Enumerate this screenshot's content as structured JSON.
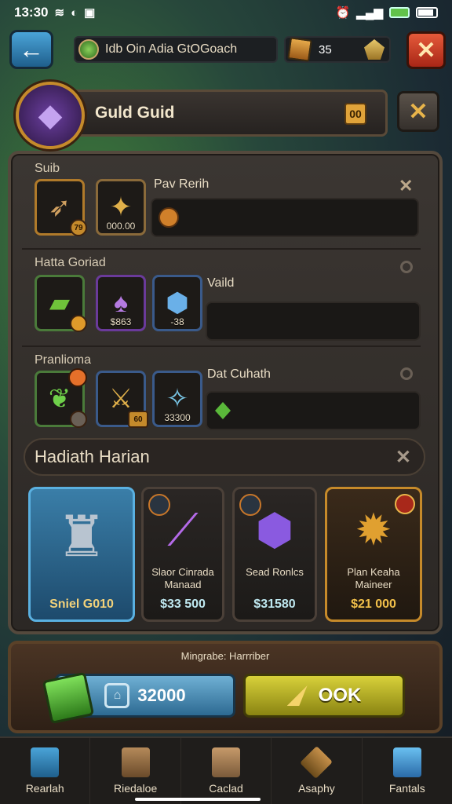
{
  "status": {
    "time": "13:30"
  },
  "topbar": {
    "player_name": "Idb Oin Adia GtOGoach",
    "currency": "35"
  },
  "guild": {
    "title": "Guld Guid",
    "badge": "00"
  },
  "sections": [
    {
      "title": "Suib",
      "items": [
        {
          "value": "",
          "badge": "79"
        },
        {
          "value": "000.00"
        }
      ],
      "label": "Pav Rerih"
    },
    {
      "title": "Hatta Goriad",
      "items": [
        {
          "value": ""
        },
        {
          "value": "$863"
        },
        {
          "value": "-38"
        }
      ],
      "label": "Vaild"
    },
    {
      "title": "Pranlioma",
      "items": [
        {
          "value": ""
        },
        {
          "value": "60"
        },
        {
          "value": "33300"
        }
      ],
      "label": "Dat Cuhath"
    }
  ],
  "shop": {
    "header": "Hadiath Harian",
    "cards": [
      {
        "name": "",
        "price": "Sniel G010"
      },
      {
        "name": "Slaor Cinrada Manaad",
        "price": "$33 500"
      },
      {
        "name": "Sead Ronlcs",
        "price": "$31580"
      },
      {
        "name": "Plan Keaha Maineer",
        "price": "$21 000"
      }
    ]
  },
  "footer": {
    "note": "Mingrabe: Harrriber",
    "buy_amount": "32000",
    "ok_label": "OOK"
  },
  "nav": [
    {
      "label": "Rearlah"
    },
    {
      "label": "Riedaloe"
    },
    {
      "label": "Caclad"
    },
    {
      "label": "Asaphy"
    },
    {
      "label": "Fantals"
    }
  ],
  "colors": {
    "accent": "#e8b44a",
    "close_red": "#d23a22",
    "ok_yellow": "#c6bd2a",
    "buy_blue": "#3f86b4"
  }
}
